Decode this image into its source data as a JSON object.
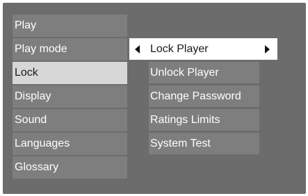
{
  "main_menu": {
    "items": [
      {
        "label": "Play"
      },
      {
        "label": "Play mode"
      },
      {
        "label": "Lock"
      },
      {
        "label": "Display"
      },
      {
        "label": "Sound"
      },
      {
        "label": "Languages"
      },
      {
        "label": "Glossary"
      }
    ],
    "selected": "Lock"
  },
  "submenu": {
    "active_item": {
      "label": "Lock Player",
      "left_icon": "triangle-left-icon",
      "right_icon": "triangle-right-icon"
    },
    "items": [
      {
        "label": "Unlock Player"
      },
      {
        "label": "Change Password"
      },
      {
        "label": "Ratings Limits"
      },
      {
        "label": "System Test"
      }
    ]
  },
  "colors": {
    "panel": "#6c6c6c",
    "item": "#7e7e7e",
    "selected_item": "#d7d7d7",
    "active_item": "#ffffff",
    "text": "#ffffff"
  }
}
